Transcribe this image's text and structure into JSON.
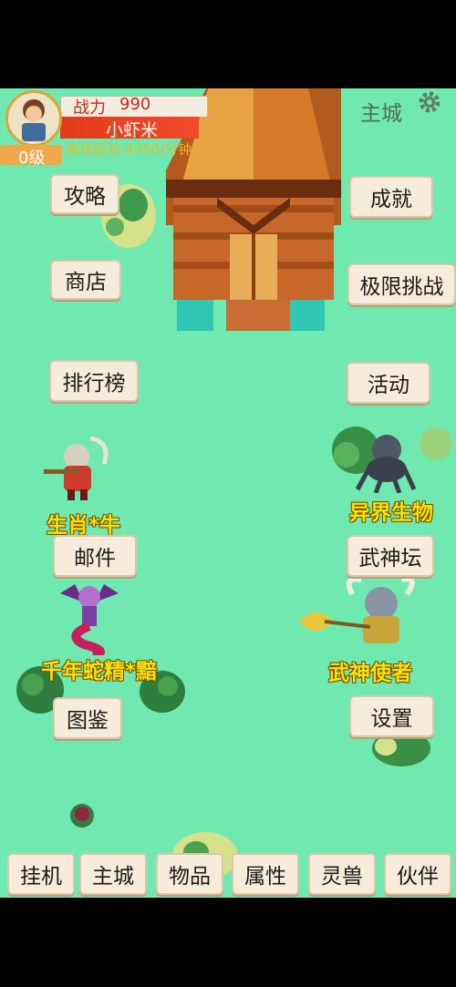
{
  "player": {
    "power_label": "战力",
    "power_value": "990",
    "name": "小虾米",
    "offline_exp": "离线经验:4350/分钟",
    "level": "0级"
  },
  "location": {
    "title": "主城",
    "settings_icon": "gear-icon"
  },
  "buttons": {
    "strategy": "攻略",
    "shop": "商店",
    "ranking": "排行榜",
    "mail": "邮件",
    "encyclopedia": "图鉴",
    "achievement": "成就",
    "extreme_challenge": "极限挑战",
    "activity": "活动",
    "altar": "武神坛",
    "settings": "设置"
  },
  "npcs": {
    "zodiac_ox": "生肖*牛",
    "snake_demon": "千年蛇精*黯",
    "alien_creature": "异界生物",
    "war_god_envoy": "武神使者"
  },
  "nav": [
    "挂机",
    "主城",
    "物品",
    "属性",
    "灵兽",
    "伙伴"
  ],
  "colors": {
    "grass": "#6fe9b0",
    "button_bg": "#f6ecd9",
    "label_yellow": "#f4e20a",
    "name_banner": "#e03b1a"
  }
}
